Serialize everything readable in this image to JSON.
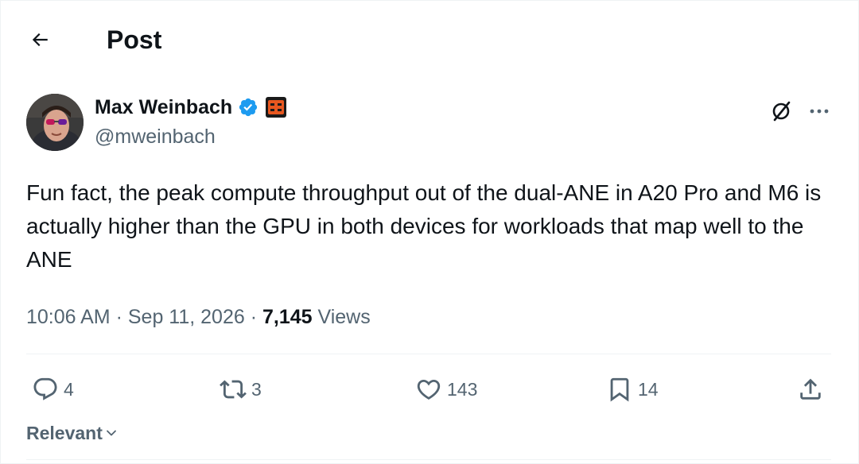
{
  "header": {
    "title": "Post",
    "back_icon": "arrow-left-icon"
  },
  "author": {
    "name": "Max Weinbach",
    "handle": "@mweinbach",
    "verified_icon": "verified-badge-icon",
    "affiliate_icon": "affiliate-badge-icon"
  },
  "tweet": {
    "text": "Fun fact, the peak compute throughput out of the dual-ANE in A20 Pro and M6 is actually higher than the GPU in both devices for workloads that map well to the ANE",
    "time": "10:06 AM",
    "sep1": " · ",
    "date": "Sep 11, 2026",
    "sep2": " · ",
    "views_count": "7,145",
    "views_label": " Views"
  },
  "actions": {
    "replies": "4",
    "reposts": "3",
    "likes": "143",
    "bookmarks": "14"
  },
  "sort": {
    "label": "Relevant"
  },
  "colors": {
    "text": "#0f1419",
    "secondary": "#536471",
    "verified": "#1d9bf0",
    "divider": "#eff3f4",
    "affiliate": "#e8571f"
  }
}
